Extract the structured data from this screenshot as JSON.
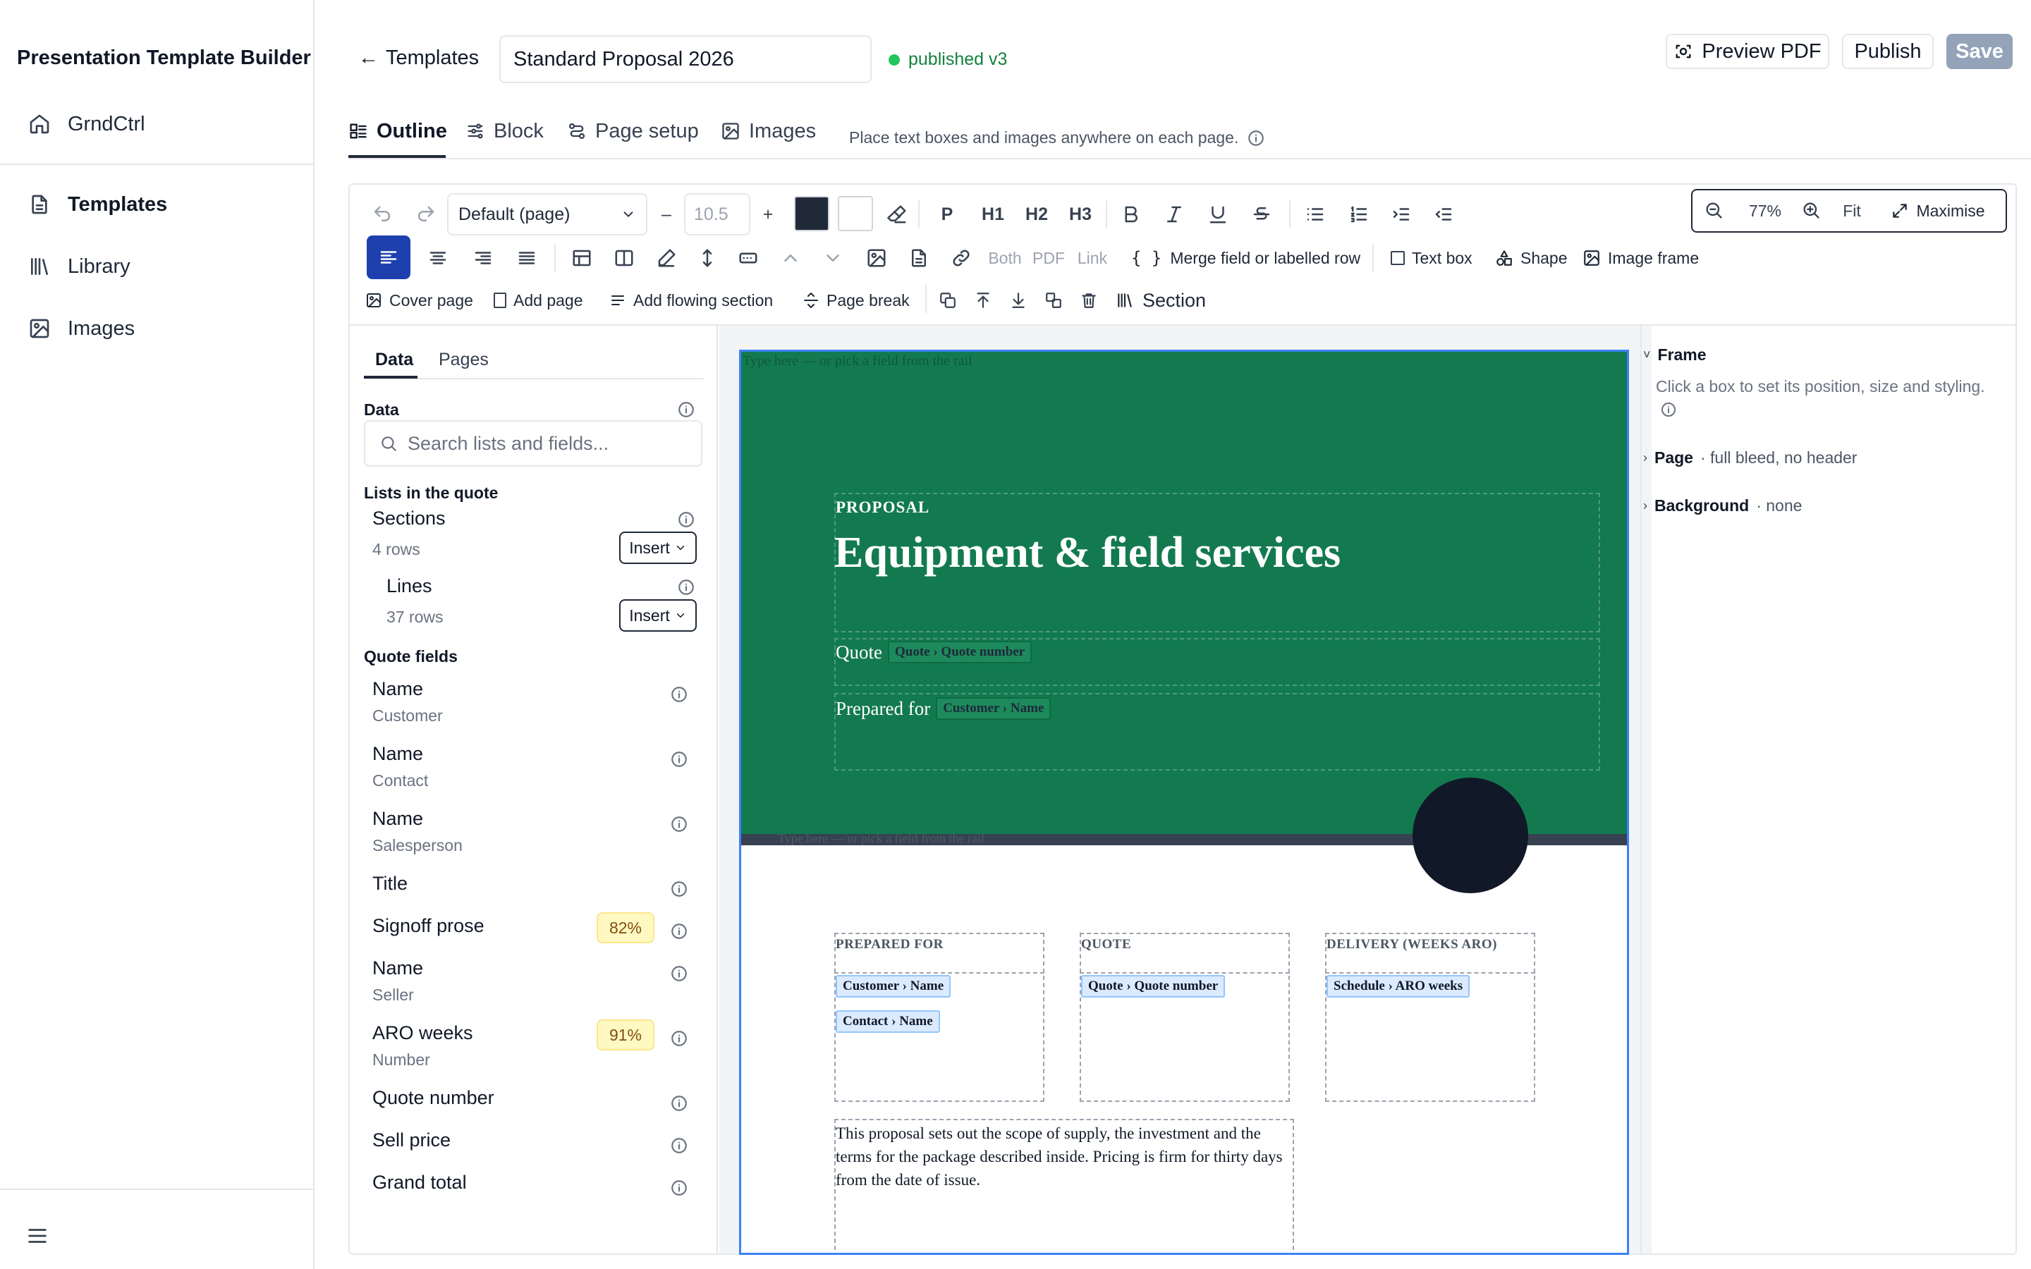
{
  "app": {
    "title": "Presentation Template Builder"
  },
  "sidebar": {
    "workspace": "GrndCtrl",
    "items": [
      {
        "label": "Templates",
        "icon": "file-text-icon"
      },
      {
        "label": "Library",
        "icon": "library-icon"
      },
      {
        "label": "Images",
        "icon": "image-icon"
      }
    ]
  },
  "header": {
    "back_label": "Templates",
    "template_name": "Standard Proposal 2026",
    "status": "published v3",
    "preview_label": "Preview PDF",
    "publish_label": "Publish",
    "save_label": "Save"
  },
  "tabs": [
    {
      "label": "Outline"
    },
    {
      "label": "Block"
    },
    {
      "label": "Page setup"
    },
    {
      "label": "Images"
    }
  ],
  "hint": "Place text boxes and images anywhere on each page.",
  "toolbar": {
    "style_select": "Default (page)",
    "font_size": "10.5",
    "minus": "–",
    "plus": "+",
    "para_labels": [
      "P",
      "H1",
      "H2",
      "H3"
    ],
    "zoom": {
      "value": "77%",
      "fit": "Fit",
      "maximise": "Maximise"
    },
    "link_modes": [
      "Both",
      "PDF",
      "Link"
    ],
    "merge_label": "Merge field or labelled row",
    "text_box": "Text box",
    "shape": "Shape",
    "image_frame": "Image frame",
    "cover_page": "Cover page",
    "add_page": "Add page",
    "add_flowing": "Add flowing section",
    "page_break": "Page break",
    "section": "Section"
  },
  "data_panel": {
    "tabs": [
      "Data",
      "Pages"
    ],
    "data_label": "Data",
    "search_placeholder": "Search lists and fields...",
    "lists_label": "Lists in the quote",
    "insert_label": "Insert",
    "lists": [
      {
        "name": "Sections",
        "rows": "4 rows"
      },
      {
        "name": "Lines",
        "rows": "37 rows"
      }
    ],
    "quote_fields_label": "Quote fields",
    "fields": [
      {
        "name": "Name",
        "sub": "Customer",
        "badge": ""
      },
      {
        "name": "Name",
        "sub": "Contact",
        "badge": ""
      },
      {
        "name": "Name",
        "sub": "Salesperson",
        "badge": ""
      },
      {
        "name": "Title",
        "sub": "",
        "badge": ""
      },
      {
        "name": "Signoff prose",
        "sub": "",
        "badge": "82%"
      },
      {
        "name": "Name",
        "sub": "Seller",
        "badge": ""
      },
      {
        "name": "ARO weeks",
        "sub": "Number",
        "badge": "91%"
      },
      {
        "name": "Quote number",
        "sub": "",
        "badge": ""
      },
      {
        "name": "Sell price",
        "sub": "",
        "badge": ""
      },
      {
        "name": "Grand total",
        "sub": "",
        "badge": ""
      }
    ]
  },
  "canvas": {
    "placeholder": "Type here — or pick a field from the rail",
    "eyebrow": "PROPOSAL",
    "headline": "Equipment & field services",
    "quote_label": "Quote",
    "quote_chip": "Quote › Quote number",
    "prepared_label": "Prepared for",
    "prepared_chip": "Customer › Name",
    "bar_placeholder": "Type here — or pick a field from the rail",
    "columns": [
      {
        "heading": "PREPARED FOR",
        "chips": [
          "Customer › Name",
          "Contact › Name"
        ]
      },
      {
        "heading": "QUOTE",
        "chips": [
          "Quote › Quote number"
        ]
      },
      {
        "heading": "DELIVERY (WEEKS ARO)",
        "chips": [
          "Schedule › ARO weeks"
        ]
      }
    ],
    "body_text": "This proposal sets out the scope of supply, the investment and the terms for the package described inside. Pricing is firm for thirty days from the date of issue.",
    "brand_green": "#137a4f",
    "selection_blue": "#3b82f6"
  },
  "inspector": {
    "frame_title": "Frame",
    "frame_hint": "Click a box to set its position, size and styling.",
    "page_title": "Page",
    "page_value": "· full bleed, no header",
    "background_title": "Background",
    "background_value": "· none"
  }
}
